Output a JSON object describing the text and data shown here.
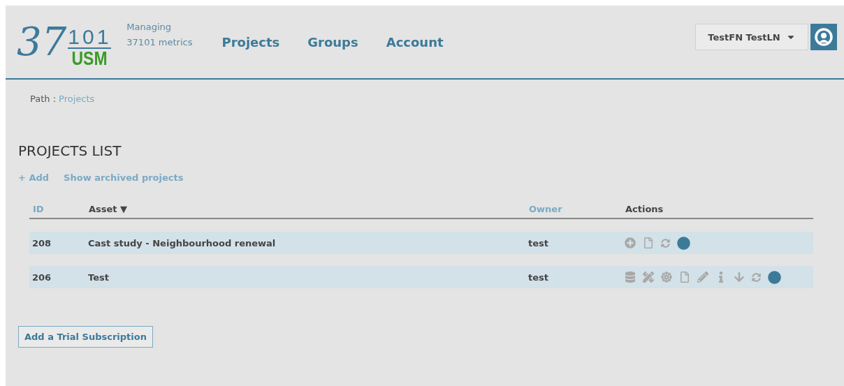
{
  "logo": {
    "numeral": "37",
    "superscript": "101",
    "acronym": "USM"
  },
  "tagline": [
    "Managing",
    "37101 metrics"
  ],
  "nav": [
    {
      "label": "Projects"
    },
    {
      "label": "Groups"
    },
    {
      "label": "Account"
    }
  ],
  "user_menu": {
    "label": "TestFN TestLN"
  },
  "breadcrumb": {
    "prefix": "Path :",
    "link": "Projects"
  },
  "page_title": "PROJECTS LIST",
  "links": [
    {
      "label": "+ Add"
    },
    {
      "label": "Show archived projects"
    }
  ],
  "table": {
    "columns": [
      {
        "label": "ID",
        "kind": "link"
      },
      {
        "label": "Asset ▼",
        "kind": "plain"
      },
      {
        "label": "Owner",
        "kind": "link"
      },
      {
        "label": "Actions",
        "kind": "plain"
      }
    ],
    "rows": [
      {
        "id": "208",
        "asset": "Cast study - Neighbourhood renewal",
        "owner": "test",
        "actions": [
          {
            "kind": "add"
          },
          {
            "kind": "file"
          },
          {
            "kind": "transfer"
          },
          {
            "kind": "status"
          }
        ]
      },
      {
        "id": "206",
        "asset": "Test",
        "owner": "test",
        "actions": [
          {
            "kind": "layers"
          },
          {
            "kind": "ruler"
          },
          {
            "kind": "wheel"
          },
          {
            "kind": "file"
          },
          {
            "kind": "pencil"
          },
          {
            "kind": "info"
          },
          {
            "kind": "download"
          },
          {
            "kind": "transfer"
          },
          {
            "kind": "status"
          }
        ]
      }
    ]
  },
  "trial_button": "Add a Trial Subscription"
}
